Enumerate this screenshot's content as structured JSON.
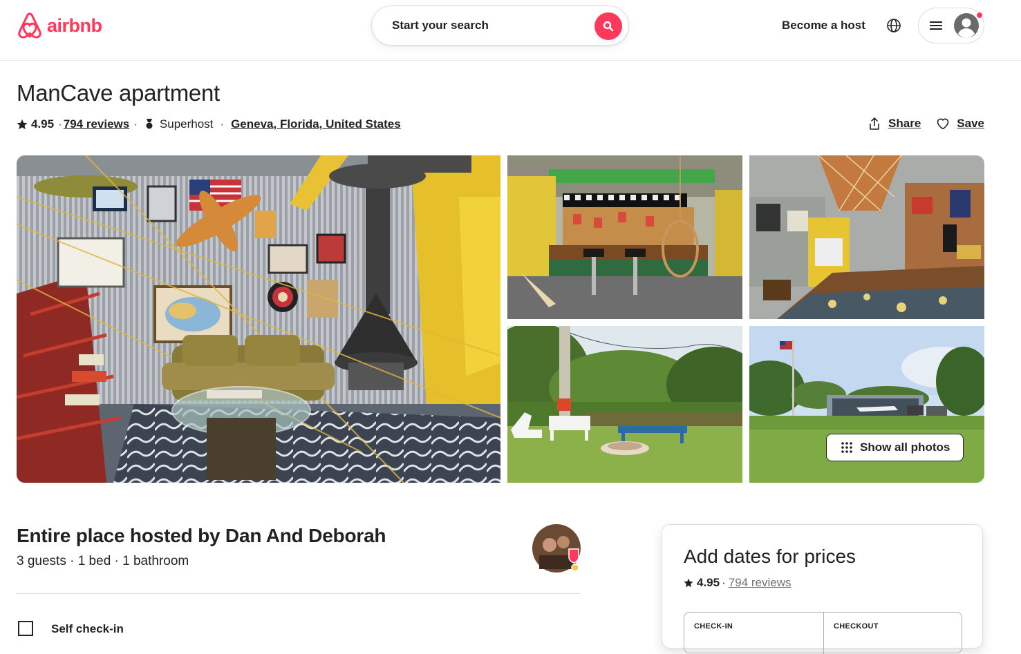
{
  "header": {
    "brand": "airbnb",
    "search_label": "Start your search",
    "become_host": "Become a host",
    "brand_color": "#ff385c"
  },
  "listing": {
    "title": "ManCave apartment",
    "rating": "4.95",
    "reviews": "794 reviews",
    "superhost": "Superhost",
    "location": "Geneva, Florida, United States",
    "share": "Share",
    "save": "Save"
  },
  "gallery": {
    "show_all": "Show all photos",
    "photos": [
      "main-living-room",
      "bar-area",
      "collectibles-room",
      "pond-fire-pit",
      "hangar-field"
    ]
  },
  "host": {
    "title": "Entire place hosted by Dan And Deborah",
    "details": "3 guests · 1 bed · 1 bathroom",
    "feature_1": "Self check-in"
  },
  "booking": {
    "title": "Add dates for prices",
    "rating": "4.95",
    "reviews": "794 reviews",
    "checkin": "CHECK-IN",
    "checkout": "CHECKOUT"
  }
}
